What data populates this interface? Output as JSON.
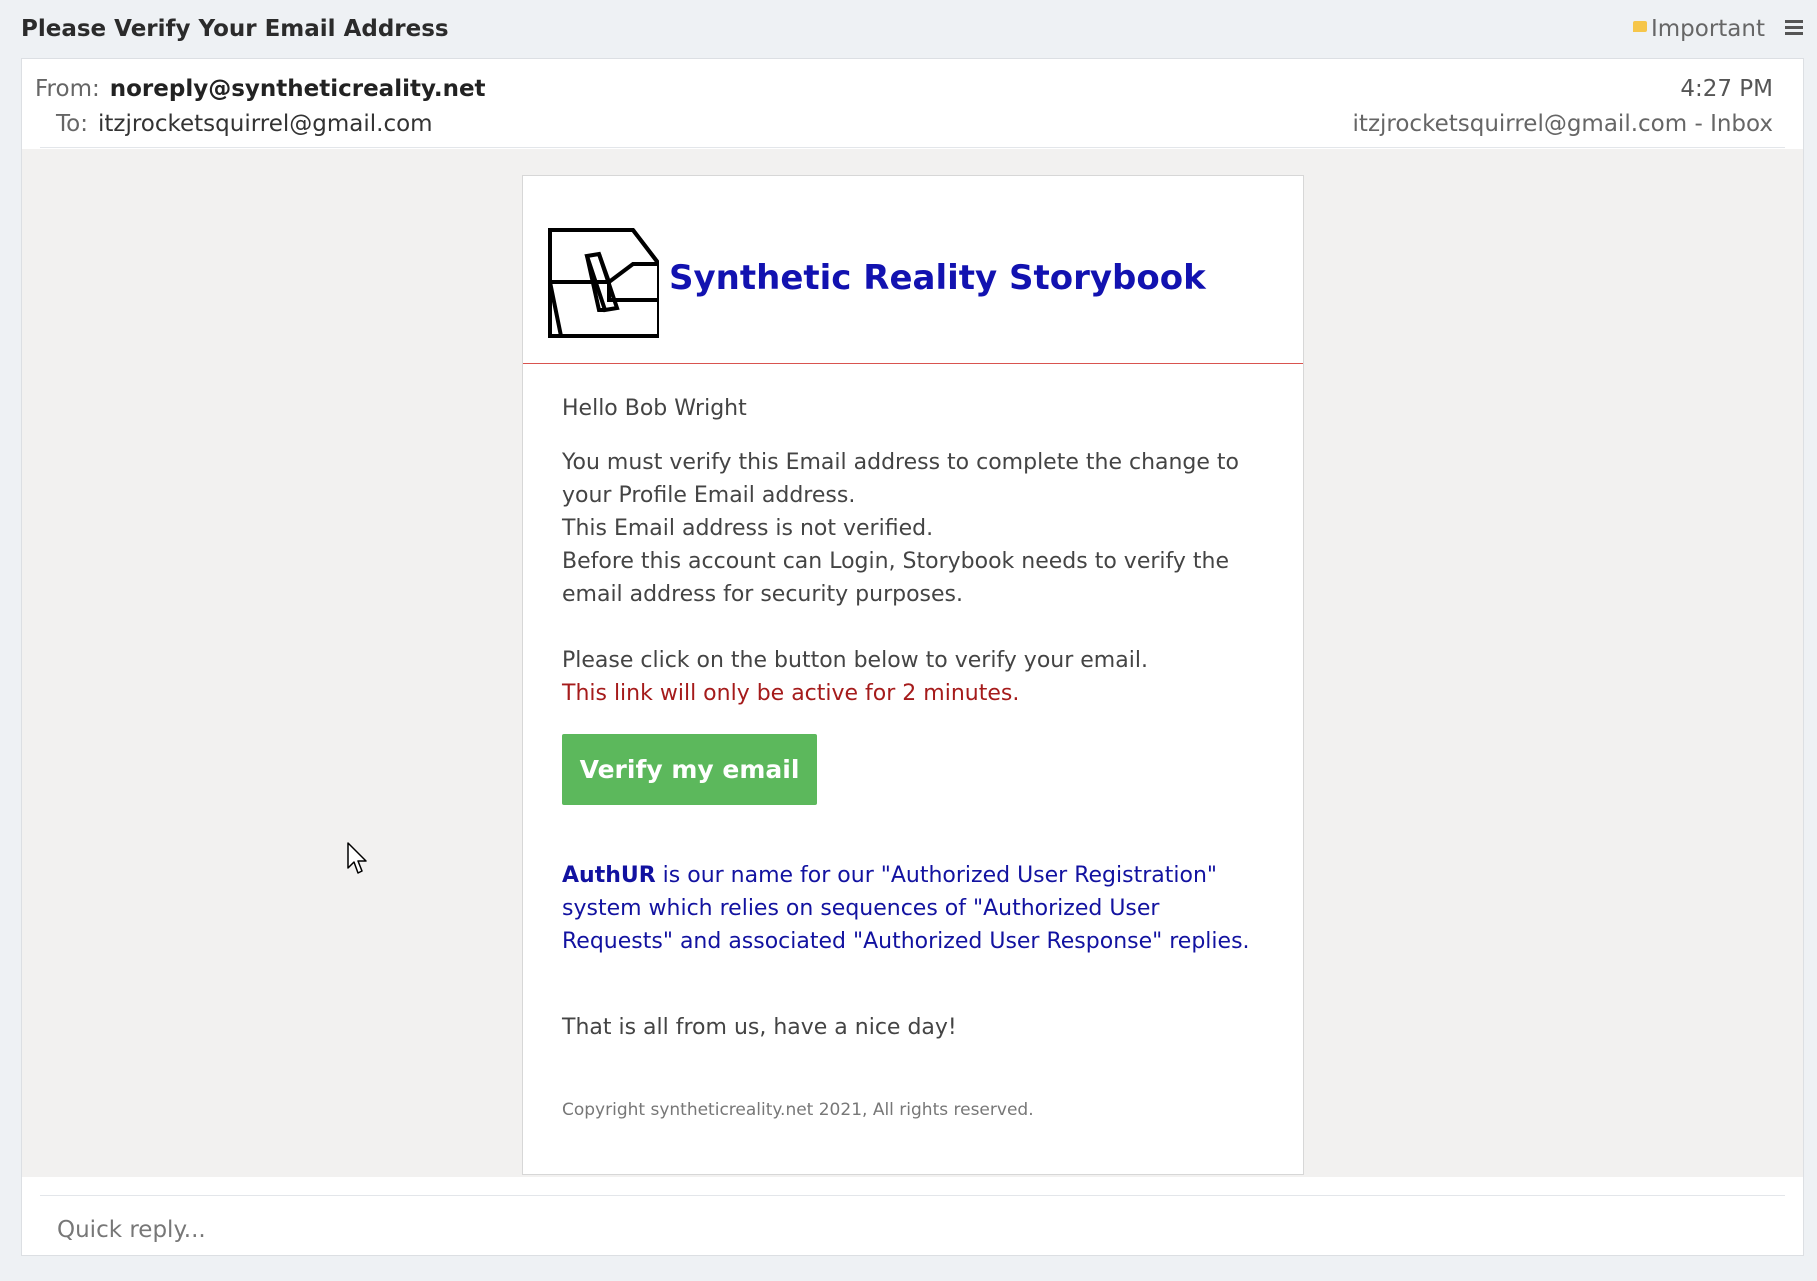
{
  "window": {
    "subject": "Please Verify Your Email Address",
    "important_label": "Important",
    "icons": {
      "important_flag": "flag-icon",
      "menu": "hamburger-menu-icon",
      "logo": "synthetic-reality-logo",
      "cursor": "mouse-cursor-icon"
    }
  },
  "header": {
    "from_label": "From:",
    "from_value": "noreply@syntheticreality.net",
    "to_label": "To:",
    "to_value": "itzjrocketsquirrel@gmail.com",
    "time": "4:27 PM",
    "account": "itzjrocketsquirrel@gmail.com - Inbox"
  },
  "message": {
    "brand_name": "Synthetic Reality Storybook",
    "greeting": "Hello Bob Wright",
    "para1_line1": "You must verify this Email address to complete the change to your Profile Email address.",
    "para1_line2": "This Email address is not verified.",
    "para1_line3": "Before this account can Login, Storybook needs to verify the email address for security purposes.",
    "para2_line1": "Please click on the button below to verify your email.",
    "warning": "This link will only be active for 2 minutes.",
    "verify_button": "Verify my email",
    "authur_name": "AuthUR",
    "authur_text": " is our name for our \"Authorized User Registration\" system which relies on sequences of \"Authorized User Requests\" and associated \"Authorized User Response\" replies.",
    "closing": "That is all from us, have a nice day!",
    "copyright": "Copyright syntheticreality.net 2021, All rights reserved."
  },
  "reply": {
    "placeholder": "Quick reply..."
  },
  "colors": {
    "brand_blue": "#1212b0",
    "button_green": "#5cb85c",
    "warning_red": "#a51b1b",
    "divider_red": "#d9534f",
    "flag_yellow": "#f6c64a"
  }
}
